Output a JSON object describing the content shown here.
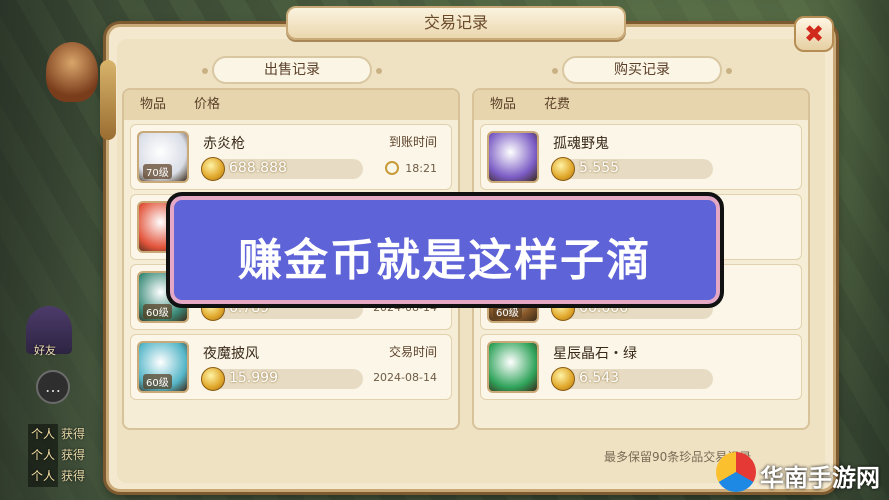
{
  "window": {
    "title": "交易记录",
    "close_glyph": "✖"
  },
  "left_column": {
    "heading": "出售记录",
    "headers": [
      "物品",
      "价格"
    ],
    "rows": [
      {
        "name": "赤炎枪",
        "level": "70级",
        "price": "688.888",
        "meta_label": "到账时间",
        "meta_value": "18:21",
        "icon_color": "#d9dde6"
      },
      {
        "name": "",
        "level": "",
        "price": "",
        "meta_label": "",
        "meta_value": "",
        "icon_color": "#e2533a"
      },
      {
        "name": "",
        "level": "60级",
        "price": "6.789",
        "meta_label": "",
        "meta_value": "2024-08-14",
        "icon_color": "#3c8c7a"
      },
      {
        "name": "夜魔披风",
        "level": "60级",
        "price": "15.999",
        "meta_label": "交易时间",
        "meta_value": "2024-08-14",
        "icon_color": "#55b6c8"
      }
    ]
  },
  "right_column": {
    "heading": "购买记录",
    "headers": [
      "物品",
      "花费"
    ],
    "rows": [
      {
        "name": "孤魂野鬼",
        "level": "",
        "price": "5.555",
        "icon_color": "#7a5bc4"
      },
      {
        "name": "",
        "level": "",
        "price": "",
        "icon_color": "#c9b27d"
      },
      {
        "name": "",
        "level": "60级",
        "price": "66.666",
        "icon_color": "#8a5a2a"
      },
      {
        "name": "星辰晶石・绿",
        "level": "",
        "price": "6.543",
        "icon_color": "#2fa35a"
      }
    ]
  },
  "footer_note": "最多保留90条珍品交易记录",
  "banner": {
    "text": "赚金币就是这样子滴"
  },
  "side": {
    "wizard_label": "好友",
    "chat_lines": [
      {
        "tag": "个人",
        "text": "获得"
      },
      {
        "tag": "个人",
        "text": "获得"
      },
      {
        "tag": "个人",
        "text": "获得"
      }
    ]
  },
  "watermark": {
    "text": "华南手游网"
  }
}
